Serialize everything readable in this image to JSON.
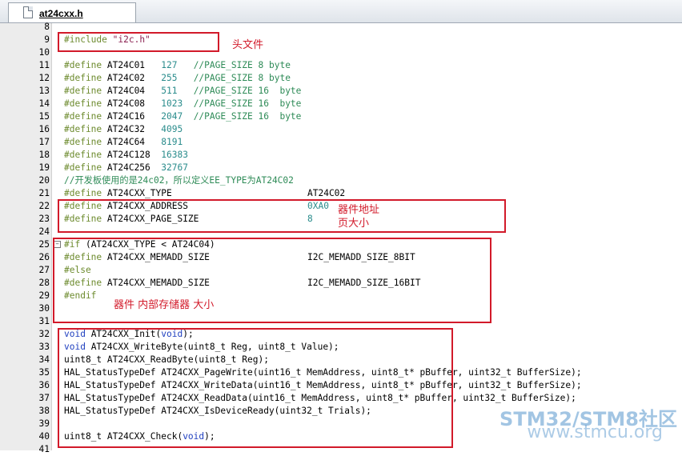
{
  "tab": {
    "filename": "at24cxx.h",
    "icon": "file-icon"
  },
  "lines": [
    {
      "n": "8",
      "t": ""
    },
    {
      "n": "9",
      "t": "#include \"i2c.h\""
    },
    {
      "n": "10",
      "t": ""
    },
    {
      "n": "11",
      "t": "#define AT24C01   127   //PAGE_SIZE 8 byte"
    },
    {
      "n": "12",
      "t": "#define AT24C02   255   //PAGE_SIZE 8 byte"
    },
    {
      "n": "13",
      "t": "#define AT24C04   511   //PAGE_SIZE 16  byte"
    },
    {
      "n": "14",
      "t": "#define AT24C08   1023  //PAGE_SIZE 16  byte"
    },
    {
      "n": "15",
      "t": "#define AT24C16   2047  //PAGE_SIZE 16  byte"
    },
    {
      "n": "16",
      "t": "#define AT24C32   4095"
    },
    {
      "n": "17",
      "t": "#define AT24C64   8191"
    },
    {
      "n": "18",
      "t": "#define AT24C128  16383"
    },
    {
      "n": "19",
      "t": "#define AT24C256  32767"
    },
    {
      "n": "20",
      "t": "//开发板使用的是24c02，所以定义EE_TYPE为AT24C02"
    },
    {
      "n": "21",
      "t": "#define AT24CXX_TYPE",
      "v": "AT24C02"
    },
    {
      "n": "22",
      "t": "#define AT24CXX_ADDRESS",
      "v": "0XA0"
    },
    {
      "n": "23",
      "t": "#define AT24CXX_PAGE_SIZE",
      "v": "8"
    },
    {
      "n": "24",
      "t": ""
    },
    {
      "n": "25",
      "t": "#if (AT24CXX_TYPE < AT24C04)"
    },
    {
      "n": "26",
      "t": "#define AT24CXX_MEMADD_SIZE",
      "v": "I2C_MEMADD_SIZE_8BIT"
    },
    {
      "n": "27",
      "t": "#else"
    },
    {
      "n": "28",
      "t": "#define AT24CXX_MEMADD_SIZE",
      "v": "I2C_MEMADD_SIZE_16BIT"
    },
    {
      "n": "29",
      "t": "#endif"
    },
    {
      "n": "30",
      "t": ""
    },
    {
      "n": "31",
      "t": ""
    },
    {
      "n": "32",
      "t": "void AT24CXX_Init(void);"
    },
    {
      "n": "33",
      "t": "void AT24CXX_WriteByte(uint8_t Reg, uint8_t Value);"
    },
    {
      "n": "34",
      "t": "uint8_t AT24CXX_ReadByte(uint8_t Reg);"
    },
    {
      "n": "35",
      "t": "HAL_StatusTypeDef AT24CXX_PageWrite(uint16_t MemAddress, uint8_t* pBuffer, uint32_t BufferSize);"
    },
    {
      "n": "36",
      "t": "HAL_StatusTypeDef AT24CXX_WriteData(uint16_t MemAddress, uint8_t* pBuffer, uint32_t BufferSize);"
    },
    {
      "n": "37",
      "t": "HAL_StatusTypeDef AT24CXX_ReadData(uint16_t MemAddress, uint8_t* pBuffer, uint32_t BufferSize);"
    },
    {
      "n": "38",
      "t": "HAL_StatusTypeDef AT24CXX_IsDeviceReady(uint32_t Trials);"
    },
    {
      "n": "39",
      "t": ""
    },
    {
      "n": "40",
      "t": "uint8_t AT24CXX_Check(void);"
    },
    {
      "n": "41",
      "t": ""
    }
  ],
  "annotations": {
    "header_file": "头文件",
    "device_address": "器件地址",
    "page_size": "页大小",
    "storage_size": "器件 内部存储器 大小"
  },
  "watermark": {
    "brand": "STM32/STM8社区",
    "url": "www.stmcu.org"
  },
  "colors": {
    "annotation_red": "#d21a2a",
    "preprocessor": "#6d8b2e",
    "number": "#2a8c8c",
    "keyword": "#1f3fbf",
    "string": "#8b2252"
  }
}
